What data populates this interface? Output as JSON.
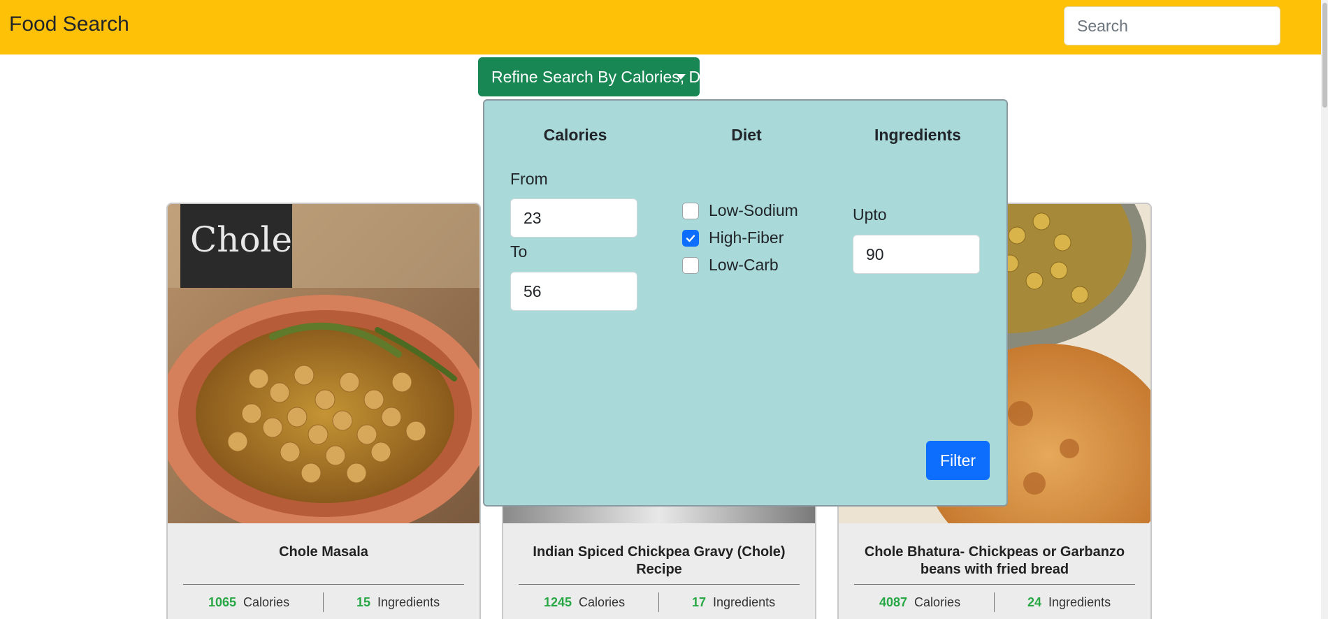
{
  "navbar": {
    "brand": "Food Search",
    "search_placeholder": "Search"
  },
  "refine": {
    "label": "Refine Search By Calories, Diet, Ingredients"
  },
  "filters": {
    "calories": {
      "heading": "Calories",
      "from_label": "From",
      "from_value": "23",
      "to_label": "To",
      "to_value": "56"
    },
    "diet": {
      "heading": "Diet",
      "options": [
        {
          "label": "Low-Sodium",
          "checked": false
        },
        {
          "label": "High-Fiber",
          "checked": true
        },
        {
          "label": "Low-Carb",
          "checked": false
        }
      ]
    },
    "ingredients": {
      "heading": "Ingredients",
      "upto_label": "Upto",
      "upto_value": "90"
    },
    "filter_label": "Filter"
  },
  "cards": [
    {
      "image_sign": "Chole",
      "title": "Chole Masala",
      "calories": "1065",
      "calories_label": "Calories",
      "ingredients": "15",
      "ingredients_label": "Ingredients"
    },
    {
      "title": "Indian Spiced Chickpea Gravy (Chole) Recipe",
      "calories": "1245",
      "calories_label": "Calories",
      "ingredients": "17",
      "ingredients_label": "Ingredients"
    },
    {
      "title": "Chole Bhatura- Chickpeas or Garbanzo beans with fried bread",
      "calories": "4087",
      "calories_label": "Calories",
      "ingredients": "24",
      "ingredients_label": "Ingredients"
    }
  ],
  "colors": {
    "navbar": "#ffc107",
    "refine_button": "#198754",
    "dropdown": "#a9dad9",
    "filter_button": "#0d6efd",
    "stat_number": "#28a745"
  }
}
